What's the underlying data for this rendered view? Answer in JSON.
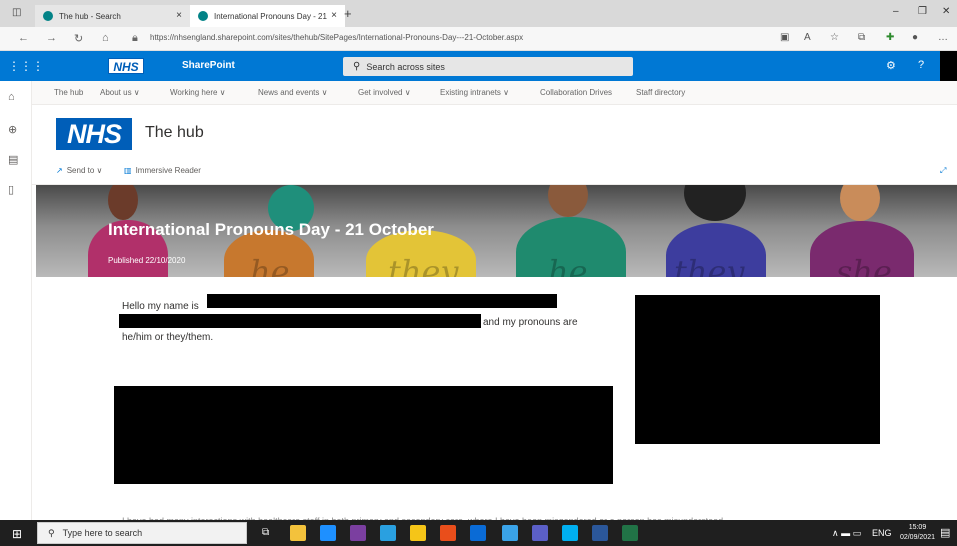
{
  "browser": {
    "tabs": [
      {
        "label": "The hub - Search",
        "active": false
      },
      {
        "label": "International Pronouns Day - 21",
        "active": true
      }
    ],
    "new_tab": "+",
    "close": "×",
    "url": "https://nhsengland.sharepoint.com/sites/thehub/SitePages/International-Pronouns-Day---21-October.aspx",
    "window_controls": {
      "minimize": "–",
      "restore": "❐",
      "close": "✕"
    }
  },
  "suite": {
    "logo_text": "NHS",
    "app_name": "SharePoint",
    "search_placeholder": "Search across sites",
    "settings_icon": "⚙",
    "help_icon": "?"
  },
  "hub_nav": [
    "The hub",
    "About us ∨",
    "Working here ∨",
    "News and events ∨",
    "Get involved ∨",
    "Existing intranets ∨",
    "Collaboration Drives",
    "Staff directory"
  ],
  "site": {
    "logo_text": "NHS",
    "title": "The hub"
  },
  "commands": {
    "send_to": "Send to ∨",
    "immersive_reader": "Immersive Reader"
  },
  "banner": {
    "title": "International Pronouns Day - 21 October",
    "published": "Published 22/10/2020",
    "words": [
      "he",
      "they",
      "he",
      "they",
      "she"
    ]
  },
  "article": {
    "line1": "Hello my name is",
    "line2_end": "and my pronouns are",
    "line3": "he/him or they/them.",
    "scroll_text": "I have had many interactions with healthcare staff in both primary and secondary care, where I have been misgendered or a person has misunderstood"
  },
  "taskbar": {
    "search_placeholder": "Type here to search",
    "time": "15:09",
    "date": "02/09/2021",
    "lang": "ENG"
  },
  "colors": {
    "suite_blue": "#0078d4",
    "nhs_blue": "#005eb8"
  }
}
